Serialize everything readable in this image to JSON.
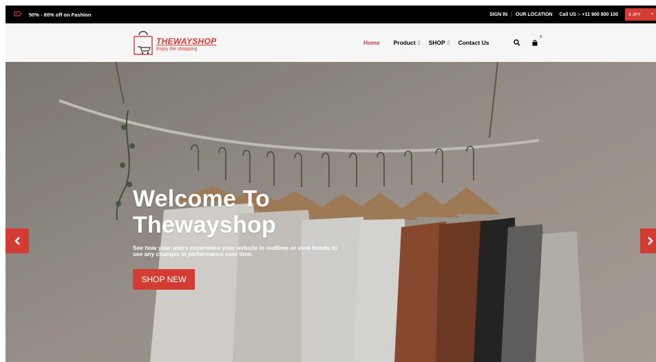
{
  "topbar": {
    "promo_text": "50% - 80% off on Fashion",
    "sign_in": "SIGN IN",
    "separator": "|",
    "location": "OUR LOCATION",
    "call_us": "Call US :- +11 900 800 100",
    "currency": "¥ JPY",
    "currency_caret": "▾"
  },
  "header": {
    "logo_name": "THEWAYSHOP",
    "logo_tagline": "Enjoy the shopping",
    "nav": {
      "home": "Home",
      "product": "Product",
      "shop": "SHOP",
      "contact": "Contact Us",
      "dropdown_glyph": "▯"
    },
    "cart_badge": "0"
  },
  "hero": {
    "title_line1": "Welcome To",
    "title_line2": "Thewayshop",
    "description": "See how your users experience your website in realtime or view trends to see any changes in performance over time.",
    "button": "SHOP NEW",
    "prev_glyph": "‹",
    "next_glyph": "›"
  },
  "colors": {
    "accent": "#d33b33",
    "topbar_bg": "#000000",
    "header_bg": "#f6f6f6"
  },
  "icons": {
    "promo": "sale-tag-icon",
    "search": "search-icon",
    "cart": "shopping-bag-icon",
    "prev": "chevron-left-icon",
    "next": "chevron-right-icon"
  }
}
